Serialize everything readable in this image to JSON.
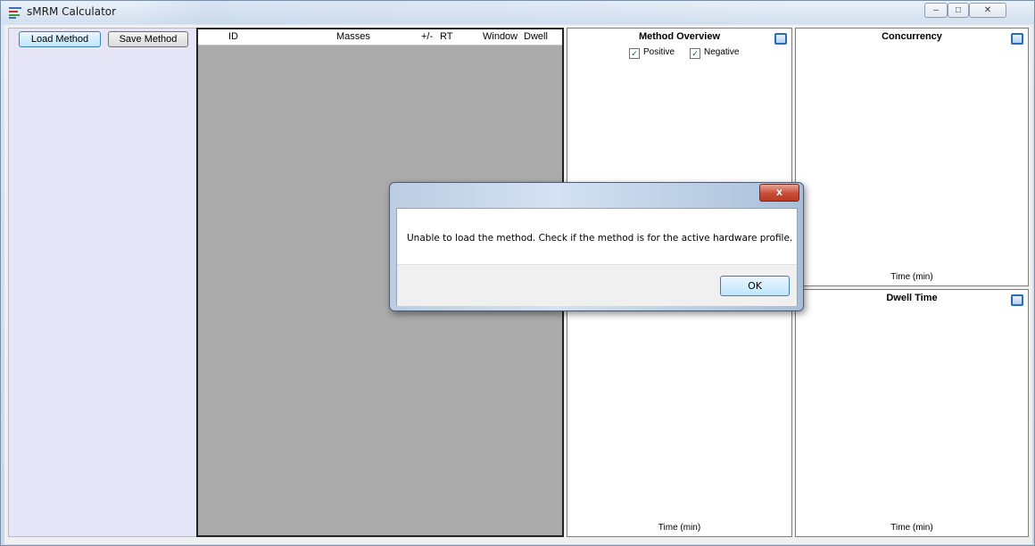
{
  "window": {
    "title": "sMRM Calculator",
    "controls": {
      "minimize": "–",
      "maximize": "□",
      "close": "✕"
    }
  },
  "toolbar": {
    "load_label": "Load Method",
    "save_label": "Save Method"
  },
  "grid": {
    "columns": [
      "ID",
      "Masses",
      "+/-",
      "RT",
      "Window",
      "Dwell"
    ]
  },
  "charts": {
    "method_overview": {
      "title": "Method Overview",
      "positive_label": "Positive",
      "negative_label": "Negative",
      "positive_checked": true,
      "negative_checked": true,
      "xlabel": "Time (min)"
    },
    "concurrency": {
      "title": "Concurrency",
      "xlabel": "Time (min)"
    },
    "dwell_time": {
      "title": "Dwell Time",
      "xlabel": "Time (min)"
    }
  },
  "dialog": {
    "message": "Unable to load the method. Check if the method is for the active hardware profile.",
    "ok_label": "OK",
    "close_glyph": "x"
  }
}
